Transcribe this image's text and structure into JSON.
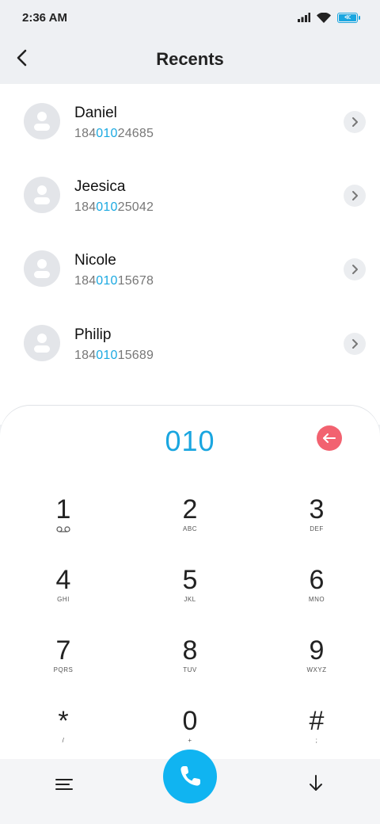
{
  "status_bar": {
    "time": "2:36 AM",
    "icons": [
      "signal-icon",
      "wifi-icon",
      "battery-charging-icon"
    ],
    "accent": "#1aa6e0"
  },
  "header": {
    "title": "Recents",
    "back_icon": "chevron-left-icon"
  },
  "contacts": [
    {
      "name": "Daniel",
      "number_pre": "184",
      "number_match": "010",
      "number_post": "24685"
    },
    {
      "name": "Jeesica",
      "number_pre": "184",
      "number_match": "010",
      "number_post": "25042"
    },
    {
      "name": "Nicole",
      "number_pre": "184",
      "number_match": "010",
      "number_post": "15678"
    },
    {
      "name": "Philip",
      "number_pre": "184",
      "number_match": "010",
      "number_post": "15689"
    }
  ],
  "dialer": {
    "input": "010",
    "input_color": "#1aa6e0",
    "backspace_color": "#f26270",
    "keys": [
      {
        "digit": "1",
        "letters": ""
      },
      {
        "digit": "2",
        "letters": "ABC"
      },
      {
        "digit": "3",
        "letters": "DEF"
      },
      {
        "digit": "4",
        "letters": "GHI"
      },
      {
        "digit": "5",
        "letters": "JKL"
      },
      {
        "digit": "6",
        "letters": "MNO"
      },
      {
        "digit": "7",
        "letters": "PQRS"
      },
      {
        "digit": "8",
        "letters": "TUV"
      },
      {
        "digit": "9",
        "letters": "WXYZ"
      },
      {
        "digit": "*",
        "letters": "/"
      },
      {
        "digit": "0",
        "letters": "+"
      },
      {
        "digit": "#",
        "letters": ";"
      }
    ]
  },
  "bottom_bar": {
    "call_color": "#10b4f1",
    "icons": [
      "menu-icon",
      "phone-icon",
      "collapse-down-icon"
    ]
  }
}
